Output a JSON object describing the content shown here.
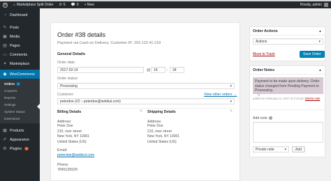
{
  "adminbar": {
    "site_name": "Marketplace Split Order",
    "updates_count": "5",
    "comments_count": "0",
    "new_label": "+ New",
    "howdy": "Howdy, admin"
  },
  "sidebar": {
    "items": [
      {
        "label": "Dashboard",
        "icon": "dashboard-icon"
      },
      {
        "label": "Posts",
        "icon": "pin-icon"
      },
      {
        "label": "Media",
        "icon": "media-icon"
      },
      {
        "label": "Pages",
        "icon": "page-icon"
      },
      {
        "label": "Comments",
        "icon": "comment-icon"
      },
      {
        "label": "Marketplace",
        "icon": "marketplace-icon"
      },
      {
        "label": "WooCommerce",
        "icon": "woo-icon"
      }
    ],
    "submenu": [
      {
        "label": "Orders",
        "badge": "1"
      },
      {
        "label": "Coupons"
      },
      {
        "label": "Reports"
      },
      {
        "label": "Settings"
      },
      {
        "label": "System Status"
      },
      {
        "label": "Extensions"
      }
    ],
    "bottom": [
      {
        "label": "Products",
        "icon": "products-icon"
      },
      {
        "label": "Appearance",
        "icon": "appearance-icon"
      },
      {
        "label": "Plugins",
        "icon": "plugins-icon",
        "badge": "4"
      }
    ]
  },
  "order": {
    "title": "Order #38 details",
    "meta": "Payment via Cash on Delivery. Customer IP: 203.122.41.218",
    "general_heading": "General Details",
    "date_label": "Order date:",
    "date_value": "2017-02-14",
    "at": "@",
    "hour": "14",
    "minute": "34",
    "status_label": "Order status:",
    "status_value": "Processing",
    "customer_label": "Customer:",
    "view_other": "View other orders →",
    "customer_value": "peterdoe (#2 – peterdoe@webkul.com)"
  },
  "billing": {
    "heading": "Billing Details",
    "address_label": "Address:",
    "address_lines": [
      "Peter Doe",
      "210, river street",
      "New York, NY 10001",
      "United States (US)"
    ],
    "email_label": "Email:",
    "email": "peterdoe@webkul.com",
    "phone_label": "Phone:",
    "phone": "7845125629"
  },
  "shipping": {
    "heading": "Shipping Details",
    "address_label": "Address:",
    "address_lines": [
      "Peter Doe",
      "210, river street",
      "New York, NY 10001",
      "United States (US)"
    ]
  },
  "actions": {
    "heading": "Order Actions",
    "select_value": "Actions",
    "trash": "Move to Trash",
    "save": "Save Order"
  },
  "notes": {
    "heading": "Order Notes",
    "note_text": "Payment to be made upon delivery. Order status changed from Pending Payment to Processing.",
    "note_meta": "added on February 14, 2017 at 2:34 pm",
    "delete_note": "Delete note",
    "add_note_label": "Add note",
    "note_type": "Private note",
    "add_button": "Add"
  },
  "colors": {
    "admin_dark": "#23282d",
    "accent": "#0073aa",
    "note_bg": "#d7cad2",
    "trash": "#a00"
  }
}
